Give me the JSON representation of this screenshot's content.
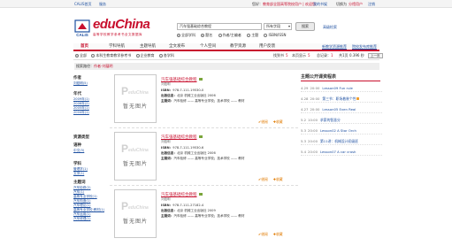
{
  "topbar": {
    "left_1": "CALIS首页",
    "left_2": "服务",
    "greeting": "您好：",
    "user": "教育部全国高等院校用户 | 欢迎您",
    "links": "我的书架",
    "switch": "切换为",
    "switch_target": "分馆用户",
    "logout": "注销"
  },
  "logo": {
    "brand": "eduChina",
    "calis": "CALIS",
    "subtitle": "高等学校教学参考书全文数据库"
  },
  "search": {
    "query": "汽车强基础综合教程",
    "field": "所有字段",
    "button": "搜索",
    "advanced": "高级检索",
    "scopes": [
      {
        "label": "全部学科",
        "on": true
      },
      {
        "label": "题名",
        "on": true
      },
      {
        "label": "作者/主编者",
        "on": false
      },
      {
        "label": "主题",
        "on": false
      },
      {
        "label": "ISBN/ISSN",
        "on": false
      }
    ]
  },
  "nav": {
    "items": [
      "首页",
      "学科导航",
      "主题导航",
      "全文发布",
      "个人空间",
      "教学资源",
      "用户反馈"
    ],
    "active_index": 0,
    "right_links": [
      "新教学资源推荐",
      "院校发布库推荐"
    ]
  },
  "filter": {
    "options": [
      {
        "label": "全部",
        "on": true
      },
      {
        "label": "本科生教育教学参考书",
        "on": false
      },
      {
        "label": "企业教育",
        "on": false
      },
      {
        "label": "各学科",
        "on": false
      }
    ],
    "found_label": "找到书",
    "found_count": "5",
    "per_page_label": "本页显示",
    "per_page": "5",
    "pages_label": "总记录：",
    "pages": "1",
    "total": "共1页",
    "time": "0.396 秒",
    "prev": "上一页",
    "next": "下一页"
  },
  "crumb": {
    "prefix": "搜索路径：",
    "path": "作者-刘蕴明"
  },
  "sidebar": {
    "groups": [
      {
        "head": "作者",
        "items": [
          "刘蕴明(5)"
        ]
      },
      {
        "head": "年代",
        "items": [
          "2009年(1)",
          "2006年(2)",
          "2005年(1)",
          "2004年(1)"
        ]
      },
      {
        "head": "语种",
        "items": [
          "中文(5)"
        ]
      },
      {
        "head": "资源类型",
        "items": [
          "图书(5)"
        ]
      },
      {
        "head": "学科",
        "items": [
          "管理学(1)",
          "文学(1)"
        ]
      },
      {
        "head": "主题词",
        "items": [
          "汽车检修(2)",
          "汽车(1)",
          "高等专业学校(1)",
          "汽车构造(1)",
          "汽车理论(1)",
          "高等专业学校·教材(1)",
          "汽车运用(1)",
          "汽车修理(1)"
        ]
      }
    ]
  },
  "books": [
    {
      "title": "汽车强基础综合教程",
      "author": "刘蕴明",
      "isbn_label": "ISBN：",
      "isbn": "978-7-111-19530-0",
      "pub_label": "出版信息：",
      "pub": "北京 机械工业出版社 2006",
      "subj_label": "主题词：",
      "subj": "汽车检修 —— 高等专业学校；技术学校 —— 教材",
      "nopic": "暂无图片",
      "borrow": "借阅",
      "collect": "收藏"
    },
    {
      "title": "汽车强基础综合教程",
      "author": "刘蕴明",
      "isbn_label": "ISBN：",
      "isbn": "978-7-111-19530-6",
      "pub_label": "出版信息：",
      "pub": "北京 机械工业出版社 2006",
      "subj_label": "主题词：",
      "subj": "汽车检修 —— 高等专业学校；技术学校 —— 教材",
      "nopic": "暂无图片",
      "borrow": "借阅",
      "collect": "收藏"
    },
    {
      "title": "汽车强基础综合教程",
      "author": "刘蕴明",
      "isbn_label": "ISBN：",
      "isbn": "978-7-111-27182-4",
      "pub_label": "出版信息：",
      "pub": "北京 机械工业出版社 2009",
      "subj_label": "主题词：",
      "subj": "汽车检修 —— 高等专业学校；技术学校 —— 教材",
      "nopic": "暂无图片",
      "borrow": "借阅",
      "collect": "收藏"
    }
  ],
  "rpanel": {
    "title": "主题公开课资程表",
    "rows": [
      {
        "date": "4.29",
        "time": "20:00",
        "title": "Lesson09 Fun rule"
      },
      {
        "date": "4.28",
        "time": "20:00",
        "title": "第三节：职场着装个性"
      },
      {
        "date": "4.27",
        "time": "20:00",
        "title": "Lesson05 Even Real"
      },
      {
        "date": "5.2",
        "time": "10:00",
        "title": "求索的智慧分"
      },
      {
        "date": "5.3",
        "time": "20:00",
        "title": "Lesson02 A Star Orch"
      },
      {
        "date": "5.3",
        "time": "20:00",
        "title": "第11讲：机械设计初级班"
      },
      {
        "date": "5.4",
        "time": "20:00",
        "title": "Lesson07 A car crash"
      }
    ]
  }
}
